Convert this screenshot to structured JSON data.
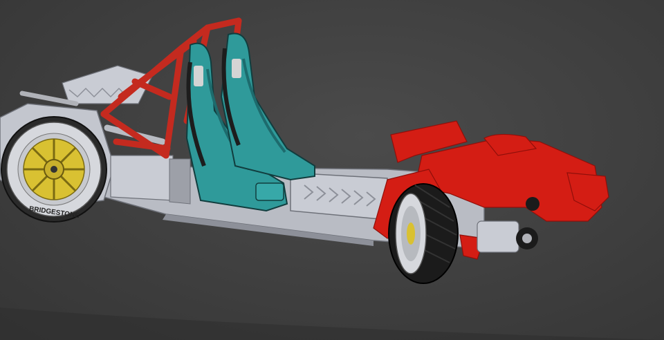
{
  "viewport": {
    "background": "#404040"
  },
  "model": {
    "colors": {
      "chassis": "#c9ccd4",
      "chassis_dark": "#8d9099",
      "rollcage": "#c42a1f",
      "seat": "#2f9a9a",
      "seat_dark": "#1d6b6d",
      "rear_section": "#d41d14",
      "tyre": "#1b1b1b",
      "rim": "#d9c132"
    },
    "tyre_sidewall_text": "BRIDGESTONE"
  }
}
